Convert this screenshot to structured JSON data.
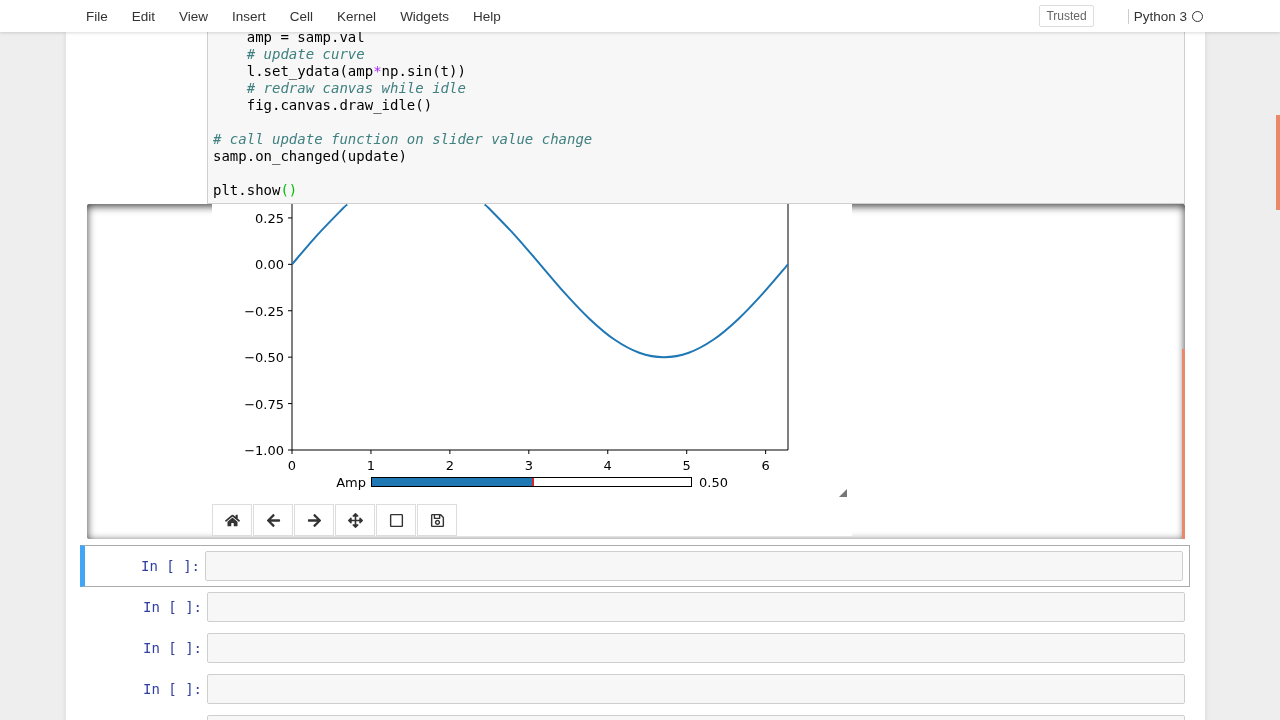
{
  "menubar": {
    "menus": [
      "File",
      "Edit",
      "View",
      "Insert",
      "Cell",
      "Kernel",
      "Widgets",
      "Help"
    ],
    "trusted": "Trusted",
    "kernel_name": "Python 3",
    "kernel_busy": false
  },
  "code_cell": {
    "lines": [
      {
        "kind": "text",
        "tokens": [
          {
            "kind": "code",
            "text": "    amp = samp.val"
          }
        ]
      },
      {
        "kind": "text",
        "tokens": [
          {
            "kind": "comment",
            "text": "    # update curve"
          }
        ]
      },
      {
        "kind": "text",
        "tokens": [
          {
            "kind": "code",
            "text": "    l.set_ydata(amp"
          },
          {
            "kind": "operator",
            "text": "*"
          },
          {
            "kind": "code",
            "text": "np.sin(t))"
          }
        ]
      },
      {
        "kind": "text",
        "tokens": [
          {
            "kind": "comment",
            "text": "    # redraw canvas while idle"
          }
        ]
      },
      {
        "kind": "text",
        "tokens": [
          {
            "kind": "code",
            "text": "    fig.canvas.draw_idle()"
          }
        ]
      },
      {
        "kind": "blank"
      },
      {
        "kind": "text",
        "tokens": [
          {
            "kind": "comment",
            "text": "# call update function on slider value change"
          }
        ]
      },
      {
        "kind": "text",
        "tokens": [
          {
            "kind": "code",
            "text": "samp.on_changed(update)"
          }
        ]
      },
      {
        "kind": "blank"
      },
      {
        "kind": "text",
        "tokens": [
          {
            "kind": "code",
            "text": "plt.show"
          },
          {
            "kind": "paren",
            "text": "()"
          }
        ]
      }
    ]
  },
  "output": {
    "chart_data": {
      "type": "line",
      "xlim": [
        0,
        6.2832
      ],
      "ylim": [
        -1,
        0.325
      ],
      "xticks": [
        {
          "value": 0,
          "label": "0"
        },
        {
          "value": 1,
          "label": "1"
        },
        {
          "value": 2,
          "label": "2"
        },
        {
          "value": 3,
          "label": "3"
        },
        {
          "value": 4,
          "label": "4"
        },
        {
          "value": 5,
          "label": "5"
        },
        {
          "value": 6,
          "label": "6"
        }
      ],
      "yticks": [
        {
          "value": -1,
          "label": "−1.00"
        },
        {
          "value": -0.75,
          "label": "−0.75"
        },
        {
          "value": -0.5,
          "label": "−0.50"
        },
        {
          "value": -0.25,
          "label": "−0.25"
        },
        {
          "value": 0,
          "label": "0.00"
        },
        {
          "value": 0.25,
          "label": "0.25"
        }
      ],
      "x": [
        0,
        0.314,
        0.628,
        0.7,
        2.44,
        2.513,
        2.827,
        3.142,
        3.456,
        3.77,
        4.084,
        4.398,
        4.712,
        5.027,
        5.341,
        5.655,
        5.969,
        6.283
      ],
      "series": [
        {
          "color": "#1f77b4",
          "values": [
            0,
            0.155,
            0.294,
            0.322,
            0.322,
            0.294,
            0.155,
            0,
            -0.155,
            -0.294,
            -0.405,
            -0.476,
            -0.5,
            -0.476,
            -0.405,
            -0.294,
            -0.155,
            0
          ]
        }
      ]
    },
    "slider": {
      "label": "Amp",
      "level": 0.5,
      "reading": "0.50"
    },
    "toolbar": [
      {
        "kind": "home"
      },
      {
        "kind": "back"
      },
      {
        "kind": "forward"
      },
      {
        "kind": "pan"
      },
      {
        "kind": "zoom"
      },
      {
        "kind": "save"
      }
    ]
  },
  "cells": [
    {
      "prompt": "In [ ]:",
      "selected": true
    },
    {
      "prompt": "In [ ]:",
      "selected": false
    },
    {
      "prompt": "In [ ]:",
      "selected": false
    },
    {
      "prompt": "In [ ]:",
      "selected": false
    },
    {
      "selected": false
    }
  ]
}
